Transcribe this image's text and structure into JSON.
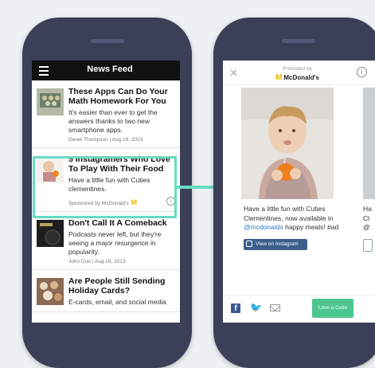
{
  "feed": {
    "nav_title": "News Feed",
    "articles": [
      {
        "title": "These Apps Can Do Your Math Homework For You",
        "description": "It's easier than ever to get the answers thanks to two new smartphone apps.",
        "meta": "Derek Thompson | Aug 19, 2013"
      },
      {
        "title": "5 Instagramers Who Love To Play With Their Food",
        "description": "Have a little fun with Cuties clementines.",
        "meta": "Sponsored by McDonald's",
        "info": "i"
      },
      {
        "title": "Don't Call It A Comeback",
        "description": "Podcasts never left, but they're seeing a major resurgence in popularity.",
        "meta": "John Doe | Aug 19, 2013"
      },
      {
        "title": "Are People Still Sending Holiday Cards?",
        "description": "E-cards, email, and social media"
      }
    ]
  },
  "ad": {
    "close": "✕",
    "promoted_label": "Promoted by",
    "brand_logo": "M",
    "brand_name": "McDonald's",
    "info": "i",
    "caption_before": "Have a little fun with Cuties Clementines, now available in ",
    "caption_handle": "@mcdonalds",
    "caption_after": " happy meals! #ad",
    "next_caption": "Ha\nCl\n@",
    "instagram_button": "View on Instagram",
    "facebook": "f",
    "twitter": "🐦",
    "love_button": "Love a Cutie"
  },
  "colors": {
    "highlight": "#67dcc1",
    "phone": "#3b3f57",
    "mcdonalds_gold": "#e8b800"
  }
}
